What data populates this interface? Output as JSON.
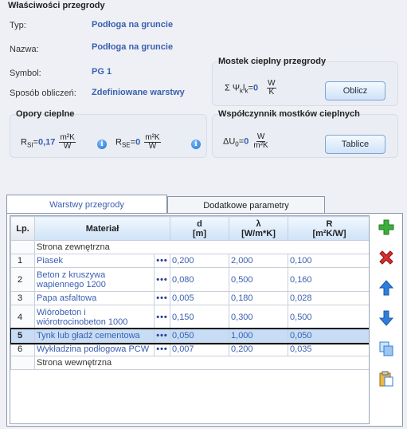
{
  "section_title": "Właściwości przegrody",
  "props": {
    "typ_label": "Typ:",
    "typ_value": "Podłoga na gruncie",
    "nazwa_label": "Nazwa:",
    "nazwa_value": "Podłoga na gruncie",
    "symbol_label": "Symbol:",
    "symbol_value": "PG 1",
    "sposob_label": "Sposób obliczeń:",
    "sposob_value": "Zdefiniowane warstwy"
  },
  "mostek": {
    "title": "Mostek cieplny przegrody",
    "sum_prefix": "Σ Ψ",
    "sum_sub": "k",
    "l_char": "l",
    "l_sub": "k",
    "sum_eq": "=",
    "sum_value": "0",
    "unit_num": "W",
    "unit_den": "K",
    "button": "Oblicz"
  },
  "opory": {
    "title": "Opory cieplne",
    "rsi_label": "R",
    "rsi_sub": "SI",
    "rsi_eq": "=",
    "rsi_value": "0,17",
    "rsi_unit_num": "m²K",
    "rsi_unit_den": "W",
    "rse_label": "R",
    "rse_sub": "SE",
    "rse_eq": "=",
    "rse_value": "0",
    "rse_unit_num": "m²K",
    "rse_unit_den": "W"
  },
  "wspolczynnik": {
    "title": "Współczynnik mostków cieplnych",
    "du_label": "ΔU",
    "du_sub": "0",
    "du_eq": "=",
    "du_value": "0",
    "unit_num": "W",
    "unit_den": "m²K",
    "button": "Tablice"
  },
  "tabs": [
    {
      "label": "Warstwy przegrody",
      "active": true
    },
    {
      "label": "Dodatkowe parametry",
      "active": false
    }
  ],
  "table": {
    "headers": {
      "lp": "Lp.",
      "material": "Materiał",
      "d": "d",
      "d_unit": "[m]",
      "lambda": "λ",
      "lambda_unit": "[W/m*K]",
      "r": "R",
      "r_unit": "[m²K/W]"
    },
    "outer": "Strona zewnętrzna",
    "inner": "Strona wewnętrzna",
    "dots": "•••",
    "rows": [
      {
        "lp": "1",
        "material": "Piasek",
        "d": "0,200",
        "lambda": "2,000",
        "r": "0,100"
      },
      {
        "lp": "2",
        "material": "Beton z kruszywa wapiennego 1200",
        "d": "0,080",
        "lambda": "0,500",
        "r": "0,160"
      },
      {
        "lp": "3",
        "material": "Papa asfaltowa",
        "d": "0,005",
        "lambda": "0,180",
        "r": "0,028"
      },
      {
        "lp": "4",
        "material": "Wióro­beton i wiórotrocinobeton 1000",
        "d": "0,150",
        "lambda": "0,300",
        "r": "0,500"
      },
      {
        "lp": "5",
        "material": "Tynk lub gładź cementowa",
        "d": "0,050",
        "lambda": "1,000",
        "r": "0,050"
      },
      {
        "lp": "6",
        "material": "Wykładzina podłogowa PCW",
        "d": "0,007",
        "lambda": "0,200",
        "r": "0,035"
      }
    ]
  },
  "colors": {
    "accent": "#3a5fb0",
    "selected_row": "#c7dcf5",
    "add": "#3cae3c",
    "delete": "#d83030",
    "arrows": "#2f7fd8"
  },
  "side_icons": [
    "add-icon",
    "delete-icon",
    "arrow-up-icon",
    "arrow-down-icon",
    "copy-icon",
    "paste-icon"
  ]
}
